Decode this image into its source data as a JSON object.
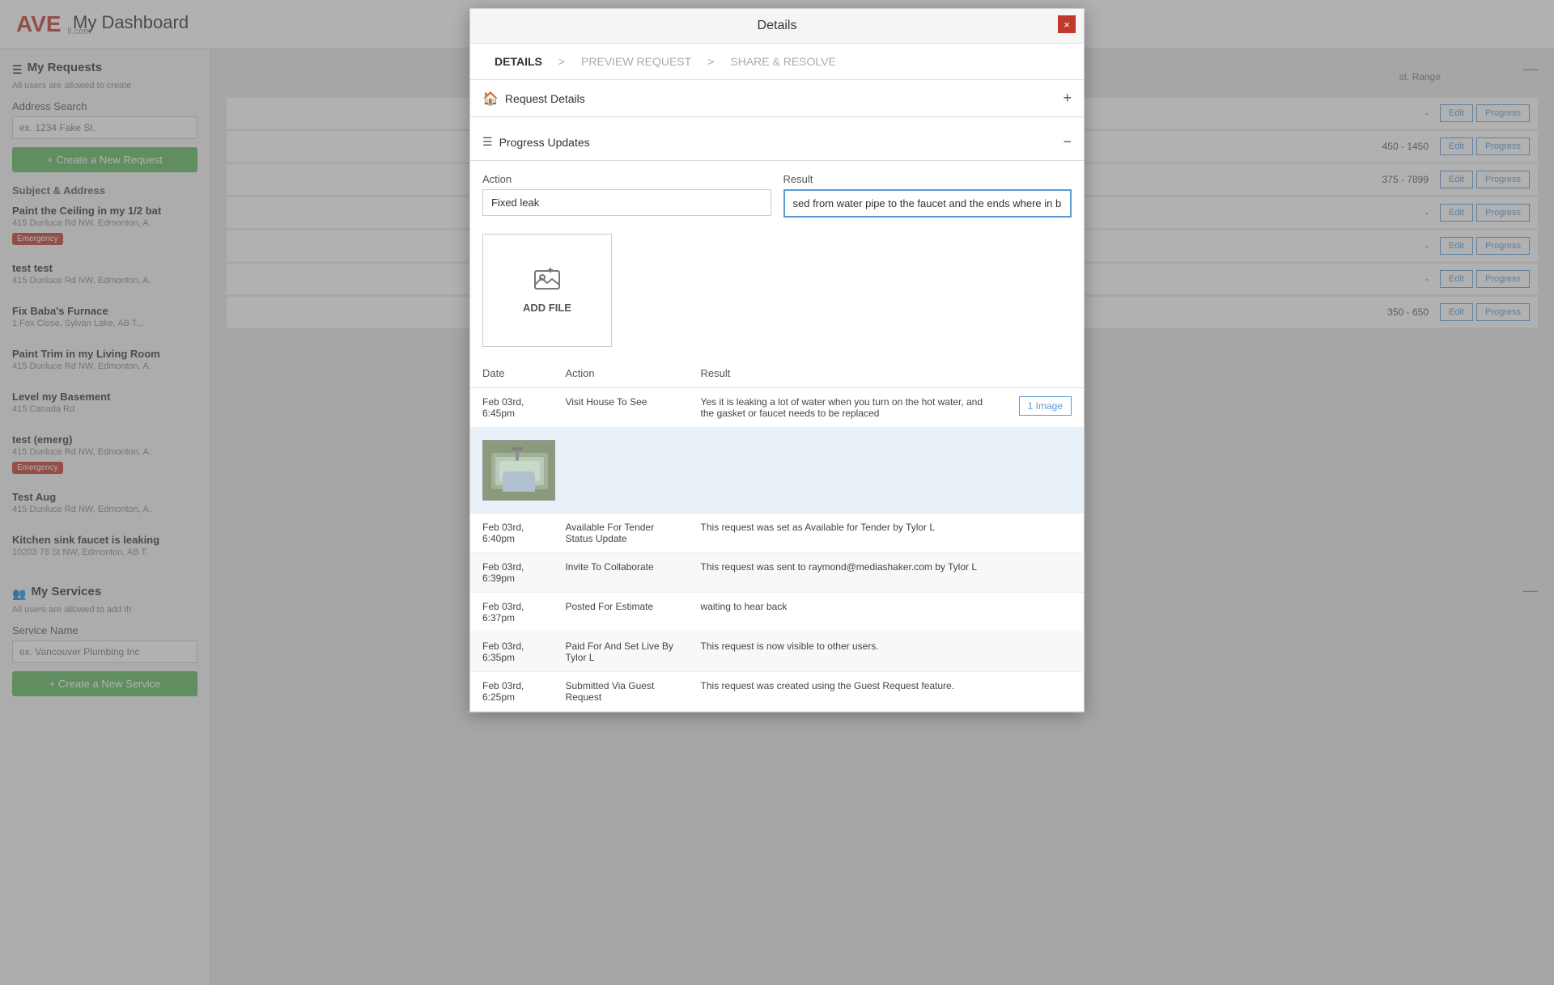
{
  "app": {
    "logo": "AVE",
    "email": "ll.com"
  },
  "dashboard": {
    "title": "My Dashboard"
  },
  "sidebar": {
    "my_requests_label": "My Requests",
    "my_requests_sub": "All users are allowed to create",
    "address_search_label": "Address Search",
    "address_search_placeholder": "ex. 1234 Fake St.",
    "create_request_btn": "+ Create a New Request",
    "subject_address_label": "Subject & Address",
    "requests": [
      {
        "title": "Paint the Ceiling in my 1/2 bat",
        "address": "415 Dunluce Rd NW, Edmonton, A.",
        "badge": "Emergency"
      },
      {
        "title": "test test",
        "address": "415 Dunluce Rd NW, Edmonton, A.",
        "badge": null
      },
      {
        "title": "Fix Baba's Furnace",
        "address": "1 Fox Close, Sylvan Lake, AB T...",
        "badge": null
      },
      {
        "title": "Paint Trim in my Living Room",
        "address": "415 Dunluce Rd NW, Edmonton, A.",
        "badge": null
      },
      {
        "title": "Level my Basement",
        "address": "415 Canada Rd",
        "badge": null
      },
      {
        "title": "test (emerg)",
        "address": "415 Dunluce Rd NW, Edmonton, A.",
        "badge": "Emergency"
      },
      {
        "title": "Test Aug",
        "address": "415 Dunluce Rd NW, Edmonton, A.",
        "badge": null
      },
      {
        "title": "Kitchen sink faucet is leaking",
        "address": "10203 78 St NW, Edmonton, AB T.",
        "badge": null
      }
    ],
    "my_services_label": "My Services",
    "my_services_sub": "All users are allowed to add th",
    "service_name_label": "Service Name",
    "service_name_placeholder": "ex. Vancouver Plumbing Inc",
    "create_service_btn": "+ Create a New Service"
  },
  "main": {
    "cost_range_header": "st. Range",
    "table_rows": [
      {
        "range": "-",
        "show_edit": true,
        "show_progress": true
      },
      {
        "range": "450 - 1450",
        "show_edit": true,
        "show_progress": true
      },
      {
        "range": "375 - 7899",
        "show_edit": true,
        "show_progress": true
      },
      {
        "range": "-",
        "show_edit": true,
        "show_progress": true
      },
      {
        "range": "-",
        "show_edit": true,
        "show_progress": true
      },
      {
        "range": "-",
        "show_edit": true,
        "show_progress": true
      },
      {
        "range": "350 - 650",
        "show_edit": true,
        "show_progress": true
      }
    ],
    "edit_label": "Edit",
    "progress_label": "Progress"
  },
  "modal": {
    "title": "Details",
    "close_label": "×",
    "steps": [
      {
        "label": "DETAILS",
        "active": true
      },
      {
        "label": ">",
        "type": "arrow"
      },
      {
        "label": "PREVIEW REQUEST",
        "active": false
      },
      {
        "label": ">",
        "type": "arrow"
      },
      {
        "label": "SHARE & RESOLVE",
        "active": false
      }
    ],
    "request_details_label": "Request Details",
    "request_details_icon": "🏠",
    "request_details_expand": "+",
    "progress_updates_label": "Progress Updates",
    "progress_updates_collapse": "−",
    "form": {
      "action_label": "Action",
      "action_value": "Fixed leak",
      "result_label": "Result",
      "result_value": "sed from water pipe to the faucet and the ends where in bad shape and leaking",
      "add_file_label": "ADD FILE"
    },
    "table": {
      "col_date": "Date",
      "col_action": "Action",
      "col_result": "Result",
      "rows": [
        {
          "date": "Feb 03rd, 6:45pm",
          "action": "Visit House To See",
          "result": "Yes it is leaking a lot of water when you turn on the hot water, and the gasket or faucet needs to be replaced",
          "image_btn": "1 Image",
          "has_image": true
        },
        {
          "date": "Feb 03rd, 6:40pm",
          "action": "Available For Tender Status Update",
          "result": "This request was set as Available for Tender by Tylor L",
          "image_btn": null,
          "has_image": false
        },
        {
          "date": "Feb 03rd, 6:39pm",
          "action": "Invite To Collaborate",
          "result": "This request was sent to raymond@mediashaker.com by Tylor L",
          "image_btn": null,
          "has_image": false
        },
        {
          "date": "Feb 03rd, 6:37pm",
          "action": "Posted For Estimate",
          "result": "waiting to hear back",
          "image_btn": null,
          "has_image": false
        },
        {
          "date": "Feb 03rd, 6:35pm",
          "action": "Paid For And Set Live By Tylor L",
          "result": "This request is now visible to other users.",
          "image_btn": null,
          "has_image": false
        },
        {
          "date": "Feb 03rd, 6:25pm",
          "action": "Submitted Via Guest Request",
          "result": "This request was created using the Guest Request feature.",
          "image_btn": null,
          "has_image": false
        }
      ]
    }
  }
}
